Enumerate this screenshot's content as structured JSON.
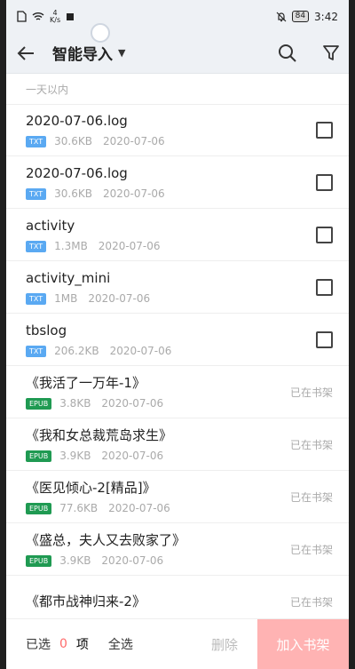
{
  "status_bar": {
    "netspeed_top": "4",
    "netspeed_bottom": "K/s",
    "battery": "84",
    "time": "3:42"
  },
  "header": {
    "title": "智能导入",
    "back_icon": "back-arrow-icon",
    "search_icon": "search-icon",
    "filter_icon": "filter-icon"
  },
  "section_label": "一天以内",
  "files": [
    {
      "name": "2020-07-06.log",
      "format": "TXT",
      "size": "30.6KB",
      "date": "2020-07-06",
      "state": "checkbox"
    },
    {
      "name": "2020-07-06.log",
      "format": "TXT",
      "size": "30.6KB",
      "date": "2020-07-06",
      "state": "checkbox"
    },
    {
      "name": "activity",
      "format": "TXT",
      "size": "1.3MB",
      "date": "2020-07-06",
      "state": "checkbox"
    },
    {
      "name": "activity_mini",
      "format": "TXT",
      "size": "1MB",
      "date": "2020-07-06",
      "state": "checkbox"
    },
    {
      "name": "tbslog",
      "format": "TXT",
      "size": "206.2KB",
      "date": "2020-07-06",
      "state": "checkbox"
    },
    {
      "name": "《我活了一万年-1》",
      "format": "EPUB",
      "size": "3.8KB",
      "date": "2020-07-06",
      "state": "已在书架"
    },
    {
      "name": "《我和女总裁荒岛求生》",
      "format": "EPUB",
      "size": "3.9KB",
      "date": "2020-07-06",
      "state": "已在书架"
    },
    {
      "name": "《医见倾心-2[精品]》",
      "format": "EPUB",
      "size": "77.6KB",
      "date": "2020-07-06",
      "state": "已在书架"
    },
    {
      "name": "《盛总，夫人又去败家了》",
      "format": "EPUB",
      "size": "3.9KB",
      "date": "2020-07-06",
      "state": "已在书架"
    },
    {
      "name": "《都市战神归来-2》",
      "format": "EPUB",
      "size": "",
      "date": "",
      "state": "已在书架"
    }
  ],
  "bottom_bar": {
    "selected_prefix": "已选",
    "selected_count": "0",
    "selected_suffix": "项",
    "select_all": "全选",
    "delete": "删除",
    "add_to_shelf": "加入书架"
  },
  "colors": {
    "accent": "#ff6b6b",
    "add_button": "#ffb3b3",
    "txt_badge": "#5aa9f2",
    "epub_badge": "#1f9a52"
  }
}
